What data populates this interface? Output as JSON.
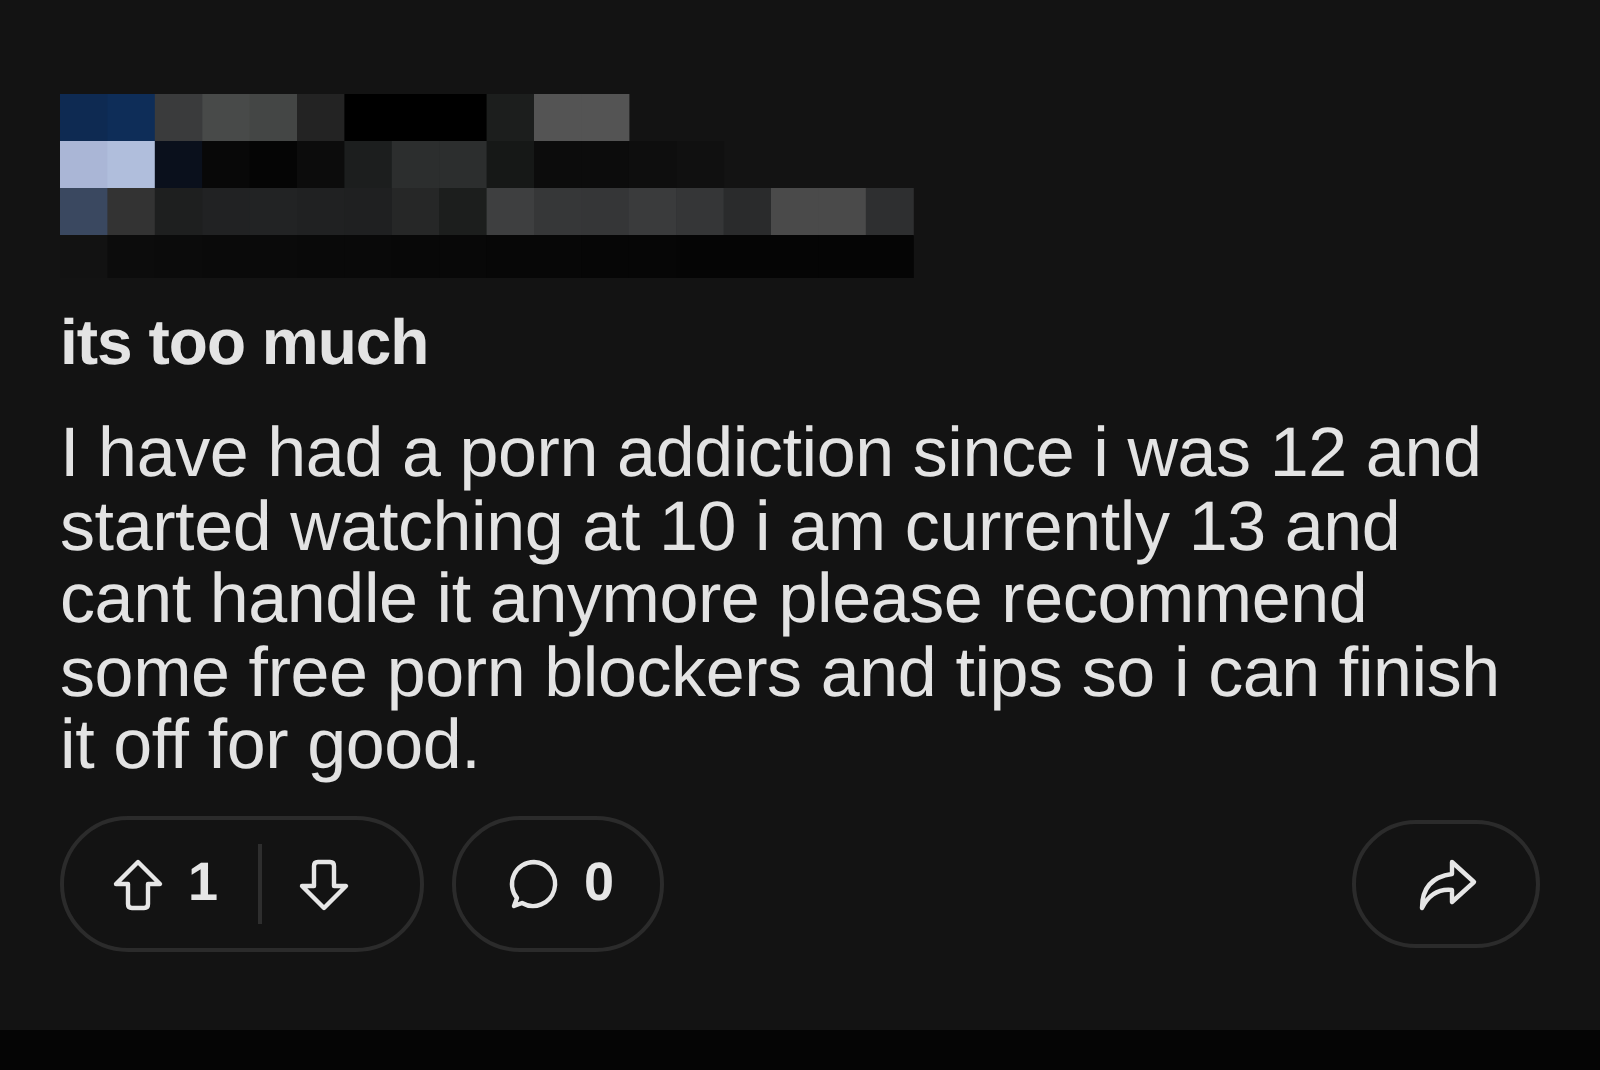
{
  "post": {
    "title": "its too much",
    "body": "I have had a porn addiction since i was 12 and started watching at 10 i am currently 13 and cant handle it anymore please recommend some free porn blockers and tips so i can finish it off for good."
  },
  "actions": {
    "votes": "1",
    "comments": "0"
  }
}
